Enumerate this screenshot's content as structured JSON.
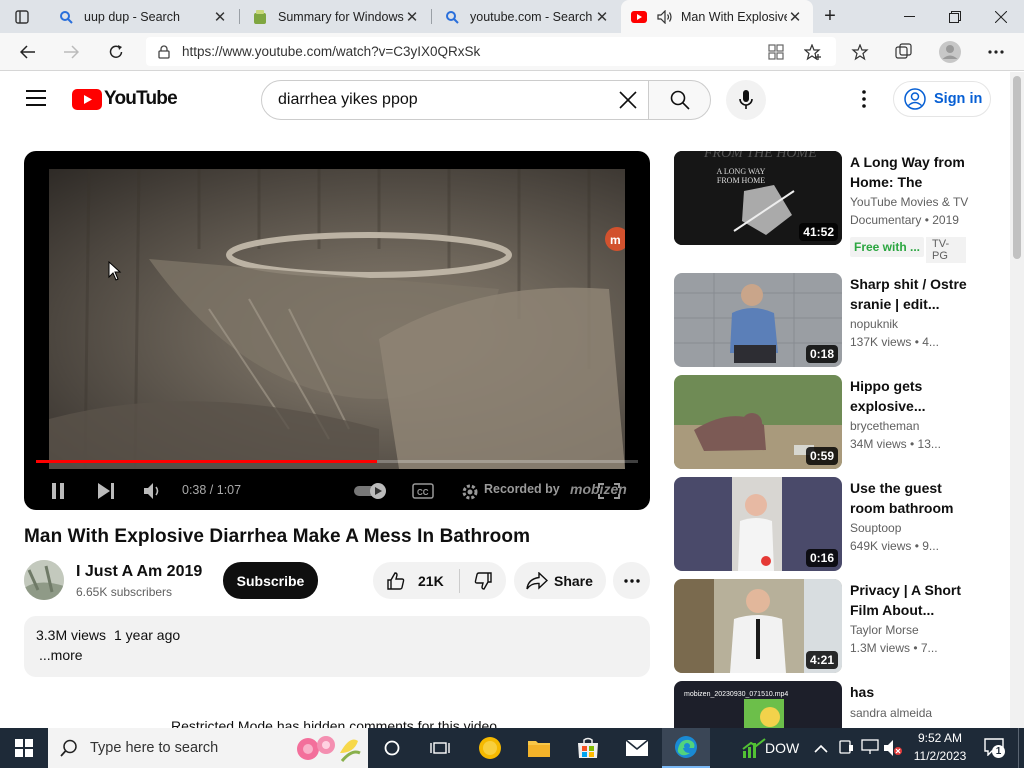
{
  "browser": {
    "tabs": [
      {
        "title": "uup dup - Search",
        "icon": "search-icon"
      },
      {
        "title": "Summary for Windows",
        "icon": "uup-favicon"
      },
      {
        "title": "youtube.com - Search",
        "icon": "search-icon"
      },
      {
        "title": "Man With Explosive",
        "icon": "youtube-favicon",
        "active": true
      }
    ],
    "url": "https://www.youtube.com/watch?v=C3yIX0QRxSk"
  },
  "youtube": {
    "logo_text": "YouTube",
    "search_query": "diarrhea yikes ppop",
    "signin_label": "Sign in"
  },
  "player": {
    "time": "0:38 / 1:07",
    "progress_fraction": 0.567,
    "watermark": "Recorded by",
    "watermark_brand": "mobizen"
  },
  "video": {
    "title": "Man With Explosive Diarrhea Make A Mess In Bathroom",
    "channel": "I Just A Am 2019",
    "subscribers": "6.65K subscribers",
    "subscribe_label": "Subscribe",
    "likes": "21K",
    "share_label": "Share",
    "views": "3.3M views",
    "age": "1 year ago",
    "more_label": "...more",
    "comments_notice": "Restricted Mode has hidden comments for this video."
  },
  "recommendations": [
    {
      "title": "A Long Way from Home: The Untol...",
      "channel": "YouTube Movies & TV",
      "meta": "Documentary • 2019",
      "duration": "41:52",
      "badge": "Free with ...",
      "rating": "TV-PG",
      "thumb_text": "A LONG WAY FROM HOME"
    },
    {
      "title": "Sharp shit / Ostre sranie | edit...",
      "channel": "nopuknik",
      "meta": "137K views • 4...",
      "duration": "0:18"
    },
    {
      "title": "Hippo gets explosive...",
      "channel": "brycetheman",
      "meta": "34M views • 13...",
      "duration": "0:59"
    },
    {
      "title": "Use the guest room bathroom",
      "channel": "Souptoop",
      "meta": "649K views • 9...",
      "duration": "0:16"
    },
    {
      "title": "Privacy | A Short Film About...",
      "channel": "Taylor Morse",
      "meta": "1.3M views • 7...",
      "duration": "4:21"
    },
    {
      "title": "has",
      "channel": "sandra almeida",
      "meta": "",
      "duration": "",
      "thumb_text": "mobizen_20230930_071510.mp4"
    }
  ],
  "taskbar": {
    "search_placeholder": "Type here to search",
    "stock_label": "DOW",
    "time": "9:52 AM",
    "date": "11/2/2023",
    "notification_count": "1"
  },
  "colors": {
    "youtube_red": "#ff0000",
    "link_blue": "#065fd4",
    "taskbar": "#1e2a38"
  }
}
